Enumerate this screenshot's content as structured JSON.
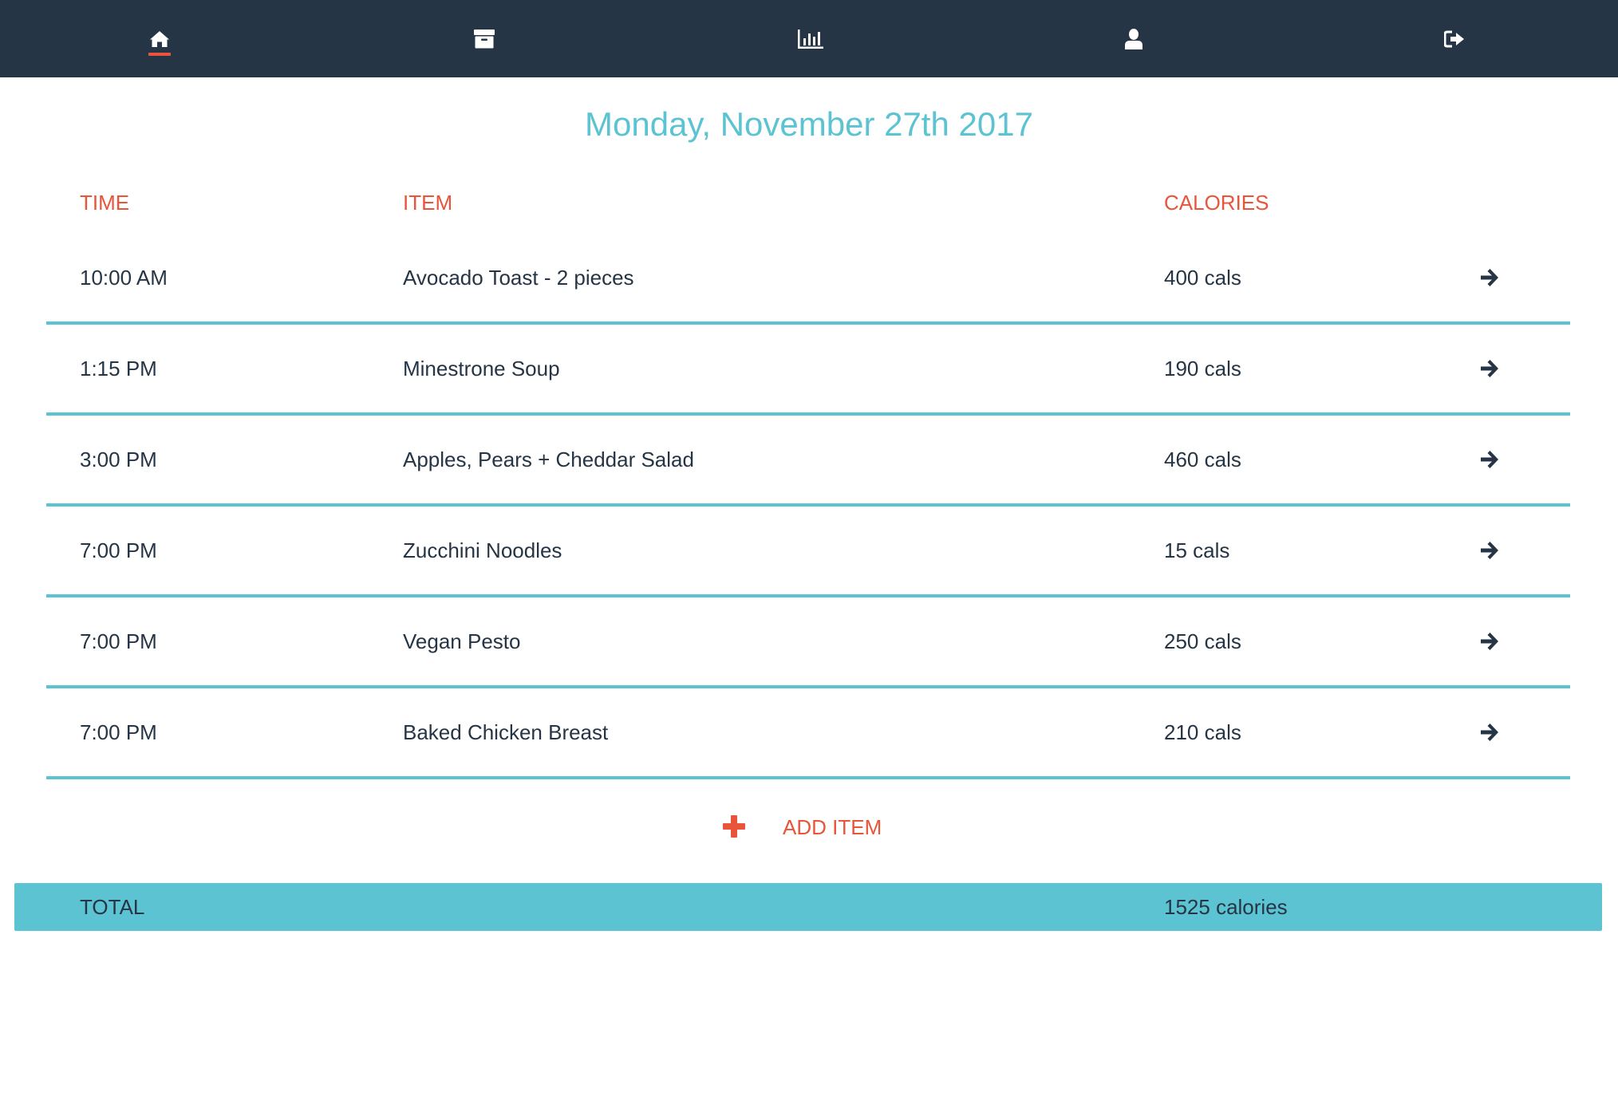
{
  "nav": {
    "items": [
      {
        "icon": "home-icon",
        "active": true
      },
      {
        "icon": "archive-icon",
        "active": false
      },
      {
        "icon": "bar-chart-icon",
        "active": false
      },
      {
        "icon": "user-icon",
        "active": false
      },
      {
        "icon": "sign-out-icon",
        "active": false
      }
    ]
  },
  "date_title": "Monday, November 27th 2017",
  "table": {
    "headers": {
      "time": "TIME",
      "item": "ITEM",
      "calories": "CALORIES"
    },
    "rows": [
      {
        "time": "10:00 AM",
        "item": "Avocado Toast - 2 pieces",
        "calories": "400 cals"
      },
      {
        "time": "1:15 PM",
        "item": "Minestrone Soup",
        "calories": "190 cals"
      },
      {
        "time": "3:00 PM",
        "item": "Apples, Pears + Cheddar Salad",
        "calories": "460 cals"
      },
      {
        "time": "7:00 PM",
        "item": "Zucchini Noodles",
        "calories": "15 cals"
      },
      {
        "time": "7:00 PM",
        "item": "Vegan Pesto",
        "calories": "250 cals"
      },
      {
        "time": "7:00 PM",
        "item": "Baked Chicken Breast",
        "calories": "210 cals"
      }
    ]
  },
  "add_item": {
    "label": "ADD ITEM"
  },
  "total": {
    "label": "TOTAL",
    "value": "1525 calories"
  },
  "colors": {
    "navbar": "#263545",
    "accent_teal": "#5bc3d1",
    "accent_orange": "#e8553a",
    "text_dark": "#263545"
  }
}
